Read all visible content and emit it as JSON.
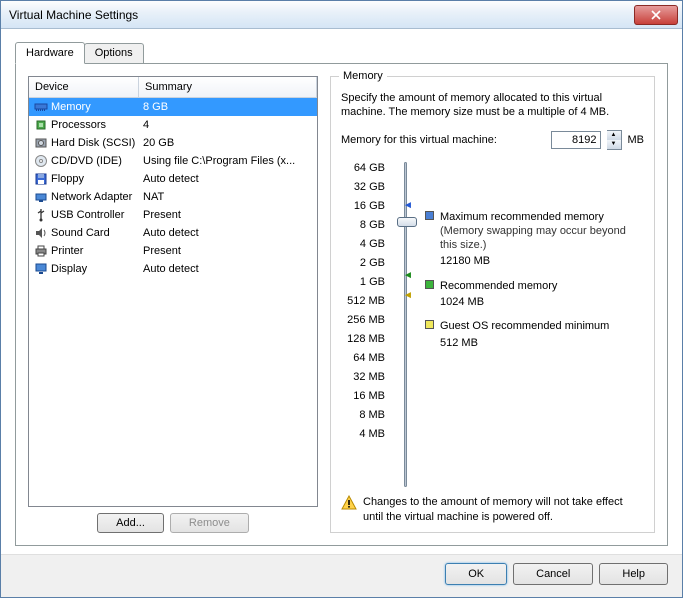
{
  "window": {
    "title": "Virtual Machine Settings"
  },
  "tabs": {
    "hardware": "Hardware",
    "options": "Options"
  },
  "list": {
    "headers": {
      "device": "Device",
      "summary": "Summary"
    },
    "rows": [
      {
        "icon": "memory-icon",
        "device": "Memory",
        "summary": "8 GB",
        "selected": true
      },
      {
        "icon": "cpu-icon",
        "device": "Processors",
        "summary": "4"
      },
      {
        "icon": "disk-icon",
        "device": "Hard Disk (SCSI)",
        "summary": "20 GB"
      },
      {
        "icon": "cd-icon",
        "device": "CD/DVD (IDE)",
        "summary": "Using file C:\\Program Files (x..."
      },
      {
        "icon": "floppy-icon",
        "device": "Floppy",
        "summary": "Auto detect"
      },
      {
        "icon": "network-icon",
        "device": "Network Adapter",
        "summary": "NAT"
      },
      {
        "icon": "usb-icon",
        "device": "USB Controller",
        "summary": "Present"
      },
      {
        "icon": "sound-icon",
        "device": "Sound Card",
        "summary": "Auto detect"
      },
      {
        "icon": "printer-icon",
        "device": "Printer",
        "summary": "Present"
      },
      {
        "icon": "display-icon",
        "device": "Display",
        "summary": "Auto detect"
      }
    ]
  },
  "buttons": {
    "add": "Add...",
    "remove": "Remove",
    "ok": "OK",
    "cancel": "Cancel",
    "help": "Help"
  },
  "memory": {
    "group_title": "Memory",
    "description": "Specify the amount of memory allocated to this virtual machine. The memory size must be a multiple of 4 MB.",
    "input_label": "Memory for this virtual machine:",
    "value": "8192",
    "unit": "MB",
    "ticks": [
      "64 GB",
      "32 GB",
      "16 GB",
      "8 GB",
      "4 GB",
      "2 GB",
      "1 GB",
      "512 MB",
      "256 MB",
      "128 MB",
      "64 MB",
      "32 MB",
      "16 MB",
      "8 MB",
      "4 MB"
    ],
    "legend": {
      "max": {
        "label": "Maximum recommended memory",
        "sub": "(Memory swapping may occur beyond this size.)",
        "value": "12180 MB"
      },
      "rec": {
        "label": "Recommended memory",
        "value": "1024 MB"
      },
      "min": {
        "label": "Guest OS recommended minimum",
        "value": "512 MB"
      }
    },
    "warning": "Changes to the amount of memory will not take effect until the virtual machine is powered off."
  }
}
